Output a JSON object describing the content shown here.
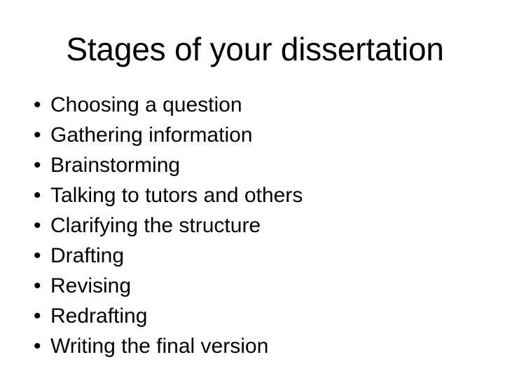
{
  "slide": {
    "title": "Stages of your dissertation",
    "background_color": "#ffffff",
    "text_color": "#000000",
    "bullet_glyph": "•",
    "bullets": [
      {
        "label": "Choosing a question"
      },
      {
        "label": "Gathering information"
      },
      {
        "label": "Brainstorming"
      },
      {
        "label": "Talking to tutors and others"
      },
      {
        "label": "Clarifying the structure"
      },
      {
        "label": "Drafting"
      },
      {
        "label": "Revising"
      },
      {
        "label": "Redrafting"
      },
      {
        "label": "Writing the final version"
      }
    ]
  }
}
